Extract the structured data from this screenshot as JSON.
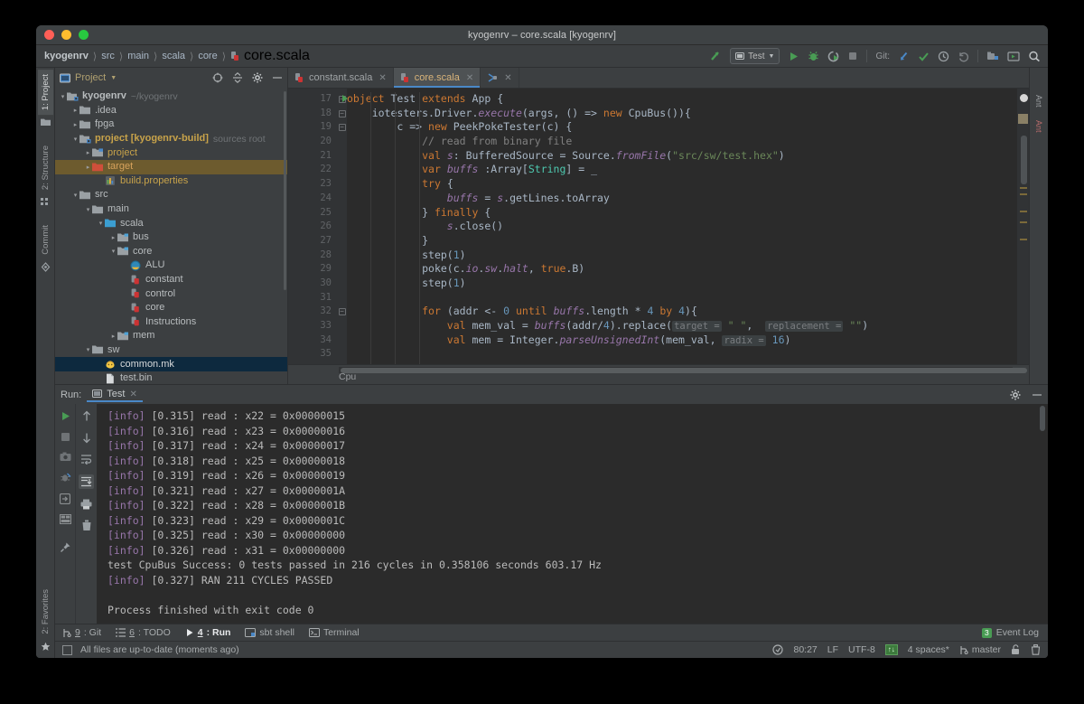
{
  "window": {
    "title": "kyogenrv – core.scala [kyogenrv]"
  },
  "breadcrumb": {
    "items": [
      "kyogenrv",
      "src",
      "main",
      "scala",
      "core"
    ],
    "file": "core.scala",
    "separator": "〉"
  },
  "toolbar": {
    "run_config": "Test",
    "git_label": "Git:",
    "icons": [
      "build-icon",
      "run-icon",
      "debug-icon",
      "run-coverage-icon",
      "stop-icon",
      "update-project-icon",
      "commit-icon",
      "history-icon",
      "rollback-icon",
      "settings-icon",
      "terminal-icon",
      "search-everywhere-icon"
    ]
  },
  "left_tool_tabs": [
    {
      "label": "1: Project",
      "active": true
    },
    {
      "label": "2: Structure",
      "active": false
    },
    {
      "label": "Commit",
      "active": false
    },
    {
      "label": "2: Favorites",
      "active": false
    }
  ],
  "right_tool_tabs": [
    {
      "label": "Ant"
    },
    {
      "label": "Ant"
    }
  ],
  "project_panel": {
    "title": "Project",
    "chevron": "▾",
    "tree": [
      {
        "depth": 0,
        "arrow": "▾",
        "icon": "module-icon",
        "label": "kyogenrv",
        "bold": true,
        "sub": "~/kyogenrv",
        "color": "#b8bcbe",
        "sel": ""
      },
      {
        "depth": 1,
        "arrow": "▸",
        "icon": "folder-icon",
        "label": ".idea",
        "bold": false,
        "sub": "",
        "color": "#b8bcbe",
        "sel": ""
      },
      {
        "depth": 1,
        "arrow": "▸",
        "icon": "folder-icon",
        "label": "fpga",
        "bold": false,
        "sub": "",
        "color": "#b8bcbe",
        "sel": ""
      },
      {
        "depth": 1,
        "arrow": "▾",
        "icon": "module-icon",
        "label": "project [kyogenrv-build]",
        "bold": true,
        "sub": "sources root",
        "color": "#c8a34a",
        "sel": ""
      },
      {
        "depth": 2,
        "arrow": "▸",
        "icon": "source-folder-icon",
        "label": "project",
        "bold": false,
        "sub": "",
        "color": "#c8a34a",
        "sel": ""
      },
      {
        "depth": 2,
        "arrow": "▸",
        "icon": "excluded-folder-icon",
        "label": "target",
        "bold": false,
        "sub": "",
        "color": "#d6a25c",
        "sel": "sel-amber"
      },
      {
        "depth": 3,
        "arrow": "",
        "icon": "properties-icon",
        "label": "build.properties",
        "bold": false,
        "sub": "",
        "color": "#c8a34a",
        "sel": ""
      },
      {
        "depth": 1,
        "arrow": "▾",
        "icon": "folder-icon",
        "label": "src",
        "bold": false,
        "sub": "",
        "color": "#b8bcbe",
        "sel": ""
      },
      {
        "depth": 2,
        "arrow": "▾",
        "icon": "folder-icon",
        "label": "main",
        "bold": false,
        "sub": "",
        "color": "#b8bcbe",
        "sel": ""
      },
      {
        "depth": 3,
        "arrow": "▾",
        "icon": "source-root-icon",
        "label": "scala",
        "bold": false,
        "sub": "",
        "color": "#b8bcbe",
        "sel": ""
      },
      {
        "depth": 4,
        "arrow": "▸",
        "icon": "package-icon",
        "label": "bus",
        "bold": false,
        "sub": "",
        "color": "#b8bcbe",
        "sel": ""
      },
      {
        "depth": 4,
        "arrow": "▾",
        "icon": "package-icon",
        "label": "core",
        "bold": false,
        "sub": "",
        "color": "#b8bcbe",
        "sel": ""
      },
      {
        "depth": 5,
        "arrow": "",
        "icon": "scala-object-icon",
        "label": "ALU",
        "bold": false,
        "sub": "",
        "color": "#b8bcbe",
        "sel": ""
      },
      {
        "depth": 5,
        "arrow": "",
        "icon": "scala-file-icon",
        "label": "constant",
        "bold": false,
        "sub": "",
        "color": "#b8bcbe",
        "sel": ""
      },
      {
        "depth": 5,
        "arrow": "",
        "icon": "scala-file-icon",
        "label": "control",
        "bold": false,
        "sub": "",
        "color": "#b8bcbe",
        "sel": ""
      },
      {
        "depth": 5,
        "arrow": "",
        "icon": "scala-file-icon",
        "label": "core",
        "bold": false,
        "sub": "",
        "color": "#b8bcbe",
        "sel": ""
      },
      {
        "depth": 5,
        "arrow": "",
        "icon": "scala-file-icon",
        "label": "Instructions",
        "bold": false,
        "sub": "",
        "color": "#b8bcbe",
        "sel": ""
      },
      {
        "depth": 4,
        "arrow": "▸",
        "icon": "package-icon",
        "label": "mem",
        "bold": false,
        "sub": "",
        "color": "#b8bcbe",
        "sel": ""
      },
      {
        "depth": 2,
        "arrow": "▾",
        "icon": "folder-icon",
        "label": "sw",
        "bold": false,
        "sub": "",
        "color": "#b8bcbe",
        "sel": ""
      },
      {
        "depth": 3,
        "arrow": "",
        "icon": "makefile-icon",
        "label": "common.mk",
        "bold": false,
        "sub": "",
        "color": "#d8dadb",
        "sel": "sel-blue"
      },
      {
        "depth": 3,
        "arrow": "",
        "icon": "binary-file-icon",
        "label": "test.bin",
        "bold": false,
        "sub": "",
        "color": "#b8bcbe",
        "sel": ""
      }
    ]
  },
  "editor": {
    "tabs": [
      {
        "label": "constant.scala",
        "icon": "scala-file-icon",
        "active": false
      },
      {
        "label": "core.scala",
        "icon": "scala-file-icon",
        "active": true
      },
      {
        "label": "",
        "icon": "diagram-icon",
        "active": false
      }
    ],
    "first_line_number": 17,
    "lines": [
      {
        "n": 17,
        "fold": "minus",
        "runmark": true,
        "html": "<span class=\"kw\">object</span> <span class=\"pln\">Test</span> <span class=\"kw\">extends</span> <span class=\"pln\">App</span> <span class=\"pln\">{</span>"
      },
      {
        "n": 18,
        "fold": "minus",
        "runmark": false,
        "html": "    <span class=\"pln\">iotesters.Driver.</span><span class=\"it\">execute</span><span class=\"pln\">(args, () =&gt; </span><span class=\"kw\">new</span><span class=\"pln\"> CpuBus()){</span>"
      },
      {
        "n": 19,
        "fold": "minus",
        "runmark": false,
        "html": "        <span class=\"pln\">c =&gt; </span><span class=\"kw\">new</span><span class=\"pln\"> PeekPokeTester(c) {</span>"
      },
      {
        "n": 20,
        "fold": "",
        "runmark": false,
        "html": "            <span class=\"cm\">// read from binary file</span>"
      },
      {
        "n": 21,
        "fold": "",
        "runmark": false,
        "html": "            <span class=\"kw\">val</span> <span class=\"it\">s</span><span class=\"pln\">: BufferedSource = Source.</span><span class=\"it\">fromFile</span><span class=\"pln\">(</span><span class=\"str\">\"src/sw/test.hex\"</span><span class=\"pln\">)</span>"
      },
      {
        "n": 22,
        "fold": "",
        "runmark": false,
        "html": "            <span class=\"kw\">var</span> <span class=\"it\">buffs</span> <span class=\"pln\">:Array[</span><span class=\"ty\">String</span><span class=\"pln\">] = _</span>"
      },
      {
        "n": 23,
        "fold": "",
        "runmark": false,
        "html": "            <span class=\"kw\">try</span> <span class=\"pln\">{</span>"
      },
      {
        "n": 24,
        "fold": "",
        "runmark": false,
        "html": "                <span class=\"it\">buffs</span> <span class=\"pln\">= </span><span class=\"it\">s</span><span class=\"pln\">.getLines.toArray</span>"
      },
      {
        "n": 25,
        "fold": "",
        "runmark": false,
        "html": "            <span class=\"pln\">} </span><span class=\"kw\">finally</span> <span class=\"pln\">{</span>"
      },
      {
        "n": 26,
        "fold": "",
        "runmark": false,
        "html": "                <span class=\"it\">s</span><span class=\"pln\">.close()</span>"
      },
      {
        "n": 27,
        "fold": "",
        "runmark": false,
        "html": "            <span class=\"pln\">}</span>"
      },
      {
        "n": 28,
        "fold": "",
        "runmark": false,
        "html": "            <span class=\"pln\">step(</span><span class=\"num\">1</span><span class=\"pln\">)</span>"
      },
      {
        "n": 29,
        "fold": "",
        "runmark": false,
        "html": "            <span class=\"pln\">poke(c.</span><span class=\"it\">io</span><span class=\"pln\">.</span><span class=\"it\">sw</span><span class=\"pln\">.</span><span class=\"it\">halt</span><span class=\"pln\">, </span><span class=\"kw\">true</span><span class=\"pln\">.B)</span>"
      },
      {
        "n": 30,
        "fold": "",
        "runmark": false,
        "html": "            <span class=\"pln\">step(</span><span class=\"num\">1</span><span class=\"pln\">)</span>"
      },
      {
        "n": 31,
        "fold": "",
        "runmark": false,
        "html": ""
      },
      {
        "n": 32,
        "fold": "minus",
        "runmark": false,
        "html": "            <span class=\"kw\">for</span> <span class=\"pln\">(addr &lt;- </span><span class=\"num\">0</span> <span class=\"kw\">until</span> <span class=\"it\">buffs</span><span class=\"pln\">.length * </span><span class=\"num\">4</span> <span class=\"kw\">by</span> <span class=\"num\">4</span><span class=\"pln\">){</span>"
      },
      {
        "n": 33,
        "fold": "",
        "runmark": false,
        "html": "                <span class=\"kw\">val</span> <span class=\"pln\">mem_val = </span><span class=\"it\">buffs</span><span class=\"pln\">(addr/</span><span class=\"num\">4</span><span class=\"pln\">).replace(</span><span class=\"hint\">target =</span> <span class=\"str\">\" \"</span><span class=\"pln\">, </span> <span class=\"hint\">replacement =</span> <span class=\"str\">\"\"</span><span class=\"pln\">)</span>"
      },
      {
        "n": 34,
        "fold": "",
        "runmark": false,
        "html": "                <span class=\"kw\">val</span> <span class=\"pln\">mem = Integer.</span><span class=\"it\">parseUnsignedInt</span><span class=\"pln\">(mem_val, </span><span class=\"hint\">radix =</span> <span class=\"num\">16</span><span class=\"pln\">)</span>"
      },
      {
        "n": 35,
        "fold": "",
        "runmark": false,
        "html": ""
      }
    ],
    "status_breadcrumb": "Cpu"
  },
  "run_window": {
    "label": "Run:",
    "tab": "Test",
    "close": "×",
    "left_tools": [
      "rerun-icon",
      "stop-icon",
      "screenshot-icon",
      "dump-threads-icon",
      "export-icon",
      "layout-icon",
      "pin-icon"
    ],
    "right_tools": [
      "scroll-up-icon",
      "scroll-down-icon",
      "soft-wrap-icon",
      "scroll-to-end-icon",
      "print-icon",
      "clear-all-icon"
    ],
    "header_icons": [
      "settings-gear-icon",
      "hide-icon"
    ],
    "console": [
      {
        "type": "info",
        "prefix": "[info]",
        "text": " [0.315] read : x22 = 0x00000015"
      },
      {
        "type": "info",
        "prefix": "[info]",
        "text": " [0.316] read : x23 = 0x00000016"
      },
      {
        "type": "info",
        "prefix": "[info]",
        "text": " [0.317] read : x24 = 0x00000017"
      },
      {
        "type": "info",
        "prefix": "[info]",
        "text": " [0.318] read : x25 = 0x00000018"
      },
      {
        "type": "info",
        "prefix": "[info]",
        "text": " [0.319] read : x26 = 0x00000019"
      },
      {
        "type": "info",
        "prefix": "[info]",
        "text": " [0.321] read : x27 = 0x0000001A"
      },
      {
        "type": "info",
        "prefix": "[info]",
        "text": " [0.322] read : x28 = 0x0000001B"
      },
      {
        "type": "info",
        "prefix": "[info]",
        "text": " [0.323] read : x29 = 0x0000001C"
      },
      {
        "type": "info",
        "prefix": "[info]",
        "text": " [0.325] read : x30 = 0x00000000"
      },
      {
        "type": "info",
        "prefix": "[info]",
        "text": " [0.326] read : x31 = 0x00000000"
      },
      {
        "type": "plain",
        "prefix": "",
        "text": "test CpuBus Success: 0 tests passed in 216 cycles in 0.358106 seconds 603.17 Hz"
      },
      {
        "type": "info",
        "prefix": "[info]",
        "text": " [0.327] RAN 211 CYCLES PASSED"
      },
      {
        "type": "plain",
        "prefix": "",
        "text": ""
      },
      {
        "type": "plain",
        "prefix": "",
        "text": "Process finished with exit code 0"
      }
    ]
  },
  "bottom_tools": [
    {
      "num": "9",
      "label": ": Git",
      "icon": "git-branch-icon",
      "active": false
    },
    {
      "num": "6",
      "label": ": TODO",
      "icon": "todo-list-icon",
      "active": false
    },
    {
      "num": "4",
      "label": ": Run",
      "icon": "run-triangle-icon",
      "active": true
    },
    {
      "num": "",
      "label": "sbt shell",
      "icon": "sbt-icon",
      "active": false
    },
    {
      "num": "",
      "label": "Terminal",
      "icon": "terminal-icon",
      "active": false
    }
  ],
  "event_log": {
    "count": "3",
    "label": "Event Log"
  },
  "status_bar": {
    "message": "All files are up-to-date (moments ago)",
    "caret_position": "80:27",
    "line_separator": "LF",
    "encoding": "UTF-8",
    "insert_badge": "↑↓",
    "indent": "4 spaces*",
    "branch": "master",
    "branch_icon": "git-branch-icon",
    "lock_icon": "unlocked-icon",
    "trash_icon": "trash-icon",
    "inspection_icon": "inspection-icon"
  },
  "colors": {
    "accent_blue": "#4a88c7",
    "green": "#499c54",
    "editor_bg": "#2b2b2b",
    "panel_bg": "#3c3f41",
    "selection_blue": "#0d293e",
    "selection_amber": "#6d5b2e"
  }
}
